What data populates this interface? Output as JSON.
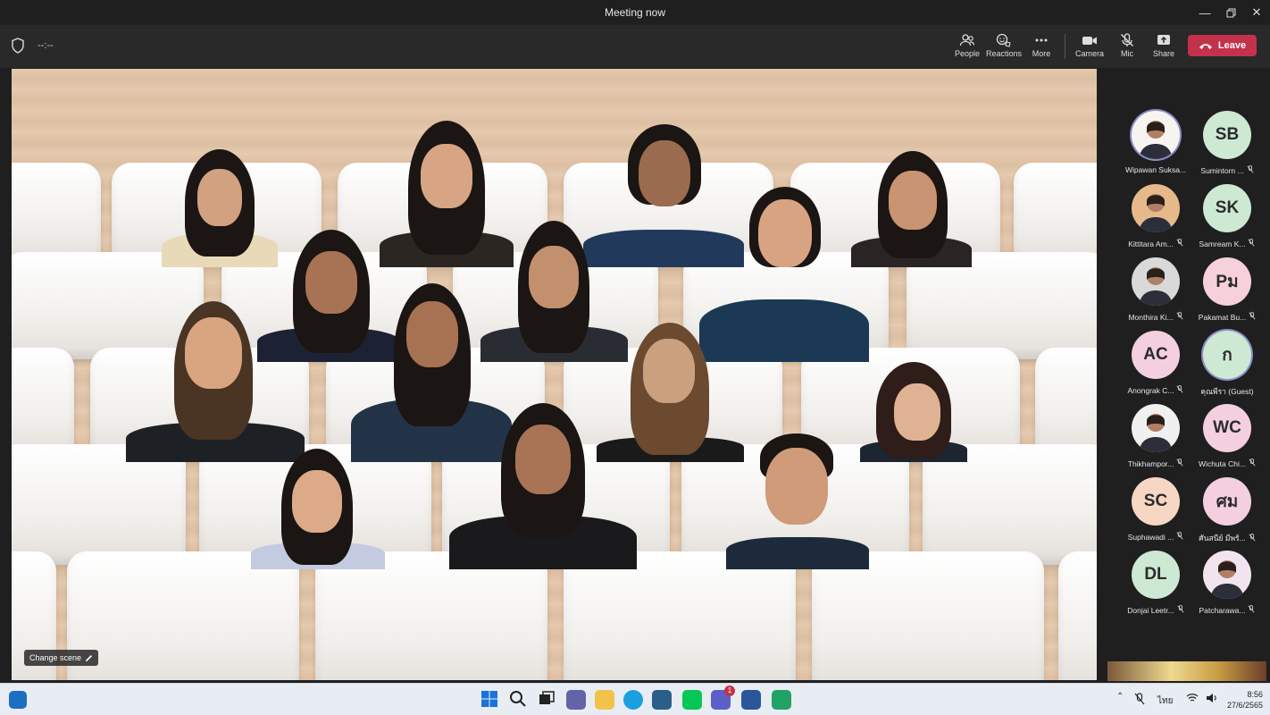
{
  "window": {
    "title": "Meeting now"
  },
  "toolbar": {
    "timer": "--:--",
    "people_label": "People",
    "reactions_label": "Reactions",
    "more_label": "More",
    "camera_label": "Camera",
    "mic_label": "Mic",
    "share_label": "Share",
    "leave_label": "Leave"
  },
  "stage": {
    "change_scene_label": "Change scene"
  },
  "participants": [
    {
      "name": "Wipawan Suksa...",
      "initials": "",
      "avatar_color": "#f7f4ef",
      "muted": false,
      "photo": true,
      "ring": true
    },
    {
      "name": "Sumintorn ...",
      "initials": "SB",
      "avatar_color": "#cde8d3",
      "muted": true,
      "photo": false,
      "ring": false
    },
    {
      "name": "Kittitara Am...",
      "initials": "",
      "avatar_color": "#e6b98b",
      "muted": true,
      "photo": true,
      "ring": false
    },
    {
      "name": "Samream K...",
      "initials": "SK",
      "avatar_color": "#cde8d3",
      "muted": true,
      "photo": false,
      "ring": false
    },
    {
      "name": "Monthira Ki...",
      "initials": "",
      "avatar_color": "#d9d9d9",
      "muted": true,
      "photo": true,
      "ring": false
    },
    {
      "name": "Pakamat Bu...",
      "initials": "Pม",
      "avatar_color": "#f6d0da",
      "muted": true,
      "photo": false,
      "ring": false
    },
    {
      "name": "Anongrak C...",
      "initials": "AC",
      "avatar_color": "#f3cfe0",
      "muted": true,
      "photo": false,
      "ring": false
    },
    {
      "name": "คุณพีรา (Guest)",
      "initials": "ก",
      "avatar_color": "#cde8d3",
      "muted": false,
      "photo": false,
      "ring": true
    },
    {
      "name": "Thikhampor...",
      "initials": "",
      "avatar_color": "#f0f0f0",
      "muted": true,
      "photo": true,
      "ring": false
    },
    {
      "name": "Wichuta Chi...",
      "initials": "WC",
      "avatar_color": "#f3cfe0",
      "muted": true,
      "photo": false,
      "ring": false
    },
    {
      "name": "Suphawadi ...",
      "initials": "SC",
      "avatar_color": "#f7d6c4",
      "muted": true,
      "photo": false,
      "ring": false
    },
    {
      "name": "ศันสนีย์ มีพร้...",
      "initials": "ศม",
      "avatar_color": "#f3cfe0",
      "muted": true,
      "photo": false,
      "ring": false
    },
    {
      "name": "Donjai Leetr...",
      "initials": "DL",
      "avatar_color": "#cde8d3",
      "muted": true,
      "photo": false,
      "ring": false
    },
    {
      "name": "Patcharawa...",
      "initials": "",
      "avatar_color": "#f2e4ee",
      "muted": true,
      "photo": true,
      "ring": false
    }
  ],
  "taskbar": {
    "language": "ไทย",
    "time": "8:56",
    "date": "27/6/2565",
    "teams_badge": "1"
  }
}
